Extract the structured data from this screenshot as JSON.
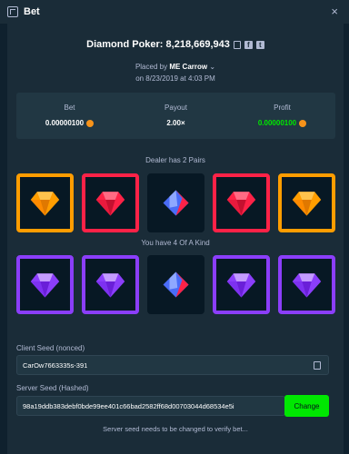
{
  "window": {
    "title": "Bet",
    "close_symbol": "×"
  },
  "game": {
    "title": "Diamond Poker: 8,218,669,943",
    "placed_by_prefix": "Placed by",
    "user": "ME Carrow",
    "placed_on": "on 8/23/2019 at 4:03 PM"
  },
  "stats": {
    "bet_label": "Bet",
    "bet_value": "0.00000100",
    "payout_label": "Payout",
    "payout_value": "2.00×",
    "profit_label": "Profit",
    "profit_value": "0.00000100"
  },
  "dealer": {
    "label": "Dealer has 2 Pairs",
    "cards": [
      {
        "gem": "orange-gem",
        "border": "#ff9d00"
      },
      {
        "gem": "red-gem",
        "border": "#fe2247"
      },
      {
        "gem": "blue-red-gem",
        "border": "none"
      },
      {
        "gem": "red-gem",
        "border": "#fe2247"
      },
      {
        "gem": "orange-gem",
        "border": "#ff9d00"
      }
    ]
  },
  "player": {
    "label": "You have 4 Of A Kind",
    "cards": [
      {
        "gem": "purple-gem",
        "border": "#8b3efa"
      },
      {
        "gem": "purple-gem",
        "border": "#8b3efa"
      },
      {
        "gem": "blue-red-gem",
        "border": "none"
      },
      {
        "gem": "purple-gem",
        "border": "#8b3efa"
      },
      {
        "gem": "purple-gem",
        "border": "#8b3efa"
      }
    ]
  },
  "seeds": {
    "client_label": "Client Seed (nonced)",
    "client_value": "CarOw7663335s-391",
    "server_label": "Server Seed (Hashed)",
    "server_value": "98a19ddb383debf0bde99ee401c66bad2582ff68d00703044d68534e5i",
    "change_label": "Change",
    "note": "Server seed needs to be changed to verify bet..."
  },
  "colors": {
    "background": "#0f212e",
    "panel": "#1a2c38",
    "accent_green": "#00e701",
    "orange": "#ff9d00",
    "red": "#fe2247",
    "purple": "#8b3efa"
  }
}
